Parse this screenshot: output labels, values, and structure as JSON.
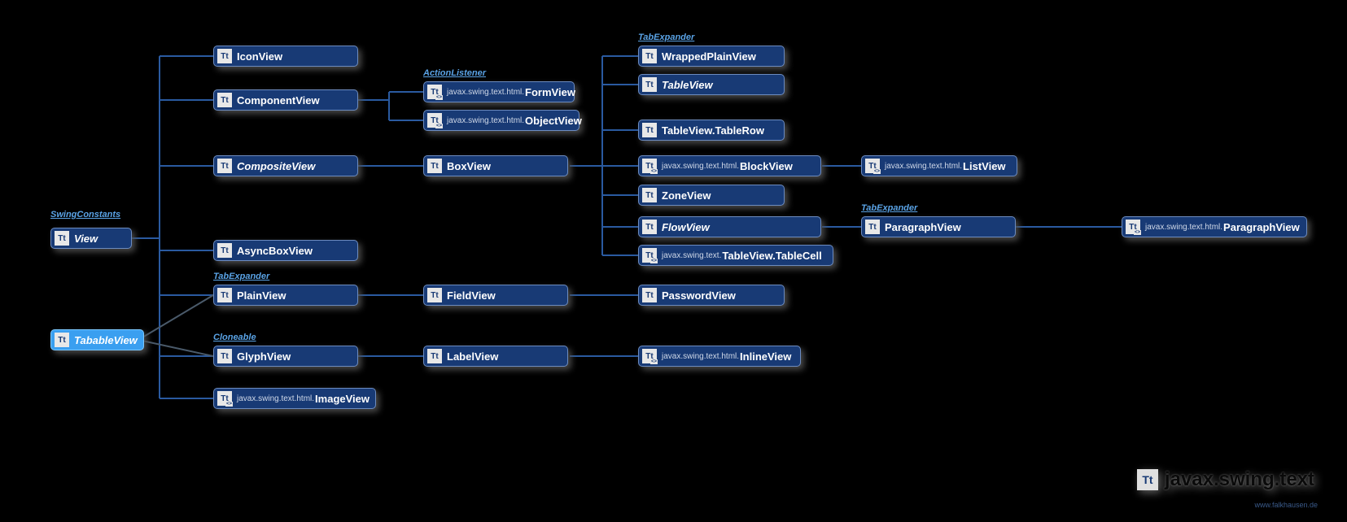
{
  "title": {
    "icon": "Tt",
    "text": "javax.swing.text"
  },
  "footer_link": "www.falkhausen.de",
  "interface_labels": {
    "swingconstants": "SwingConstants",
    "actionlistener": "ActionListener",
    "tabexpander_top": "TabExpander",
    "tabexpander_mid": "TabExpander",
    "tabexpander_right": "TabExpander",
    "cloneable": "Cloneable"
  },
  "nodes": {
    "view": {
      "icon": "Tt",
      "prefix": "",
      "name": "View",
      "italic": true
    },
    "tabableview": {
      "icon": "Tt",
      "prefix": "",
      "name": "TabableView",
      "italic": true
    },
    "iconview": {
      "icon": "Tt",
      "prefix": "",
      "name": "IconView"
    },
    "componentview": {
      "icon": "Tt",
      "prefix": "",
      "name": "ComponentView"
    },
    "compositeview": {
      "icon": "Tt",
      "prefix": "",
      "name": "CompositeView",
      "italic": true
    },
    "asyncboxview": {
      "icon": "Tt",
      "prefix": "",
      "name": "AsyncBoxView"
    },
    "plainview": {
      "icon": "Tt",
      "prefix": "",
      "name": "PlainView"
    },
    "glyphview": {
      "icon": "Tt",
      "prefix": "",
      "name": "GlyphView"
    },
    "imageview": {
      "icon": "Tt",
      "alt": true,
      "prefix": "javax.swing.text.html.",
      "name": "ImageView"
    },
    "formview": {
      "icon": "Tt",
      "alt": true,
      "prefix": "javax.swing.text.html.",
      "name": "FormView"
    },
    "objectview": {
      "icon": "Tt",
      "alt": true,
      "prefix": "javax.swing.text.html.",
      "name": "ObjectView"
    },
    "boxview": {
      "icon": "Tt",
      "prefix": "",
      "name": "BoxView"
    },
    "fieldview": {
      "icon": "Tt",
      "prefix": "",
      "name": "FieldView"
    },
    "labelview": {
      "icon": "Tt",
      "prefix": "",
      "name": "LabelView"
    },
    "wrappedplainview": {
      "icon": "Tt",
      "prefix": "",
      "name": "WrappedPlainView"
    },
    "tableview": {
      "icon": "Tt",
      "prefix": "",
      "name": "TableView",
      "italic": true
    },
    "tableviewrow": {
      "icon": "Tt",
      "prefix": "",
      "name": "TableView.TableRow"
    },
    "blockview": {
      "icon": "Tt",
      "alt": true,
      "prefix": "javax.swing.text.html.",
      "name": "BlockView"
    },
    "zoneview": {
      "icon": "Tt",
      "prefix": "",
      "name": "ZoneView"
    },
    "flowview": {
      "icon": "Tt",
      "prefix": "",
      "name": "FlowView",
      "italic": true
    },
    "tableviewcell": {
      "icon": "Tt",
      "alt": true,
      "prefix": "javax.swing.text.",
      "name": "TableView.TableCell"
    },
    "passwordview": {
      "icon": "Tt",
      "prefix": "",
      "name": "PasswordView"
    },
    "inlineview": {
      "icon": "Tt",
      "alt": true,
      "prefix": "javax.swing.text.html.",
      "name": "InlineView"
    },
    "listview": {
      "icon": "Tt",
      "alt": true,
      "prefix": "javax.swing.text.html.",
      "name": "ListView"
    },
    "paragraphview": {
      "icon": "Tt",
      "prefix": "",
      "name": "ParagraphView"
    },
    "paragraphview_html": {
      "icon": "Tt",
      "alt": true,
      "prefix": "javax.swing.text.html.",
      "name": "ParagraphView"
    }
  }
}
